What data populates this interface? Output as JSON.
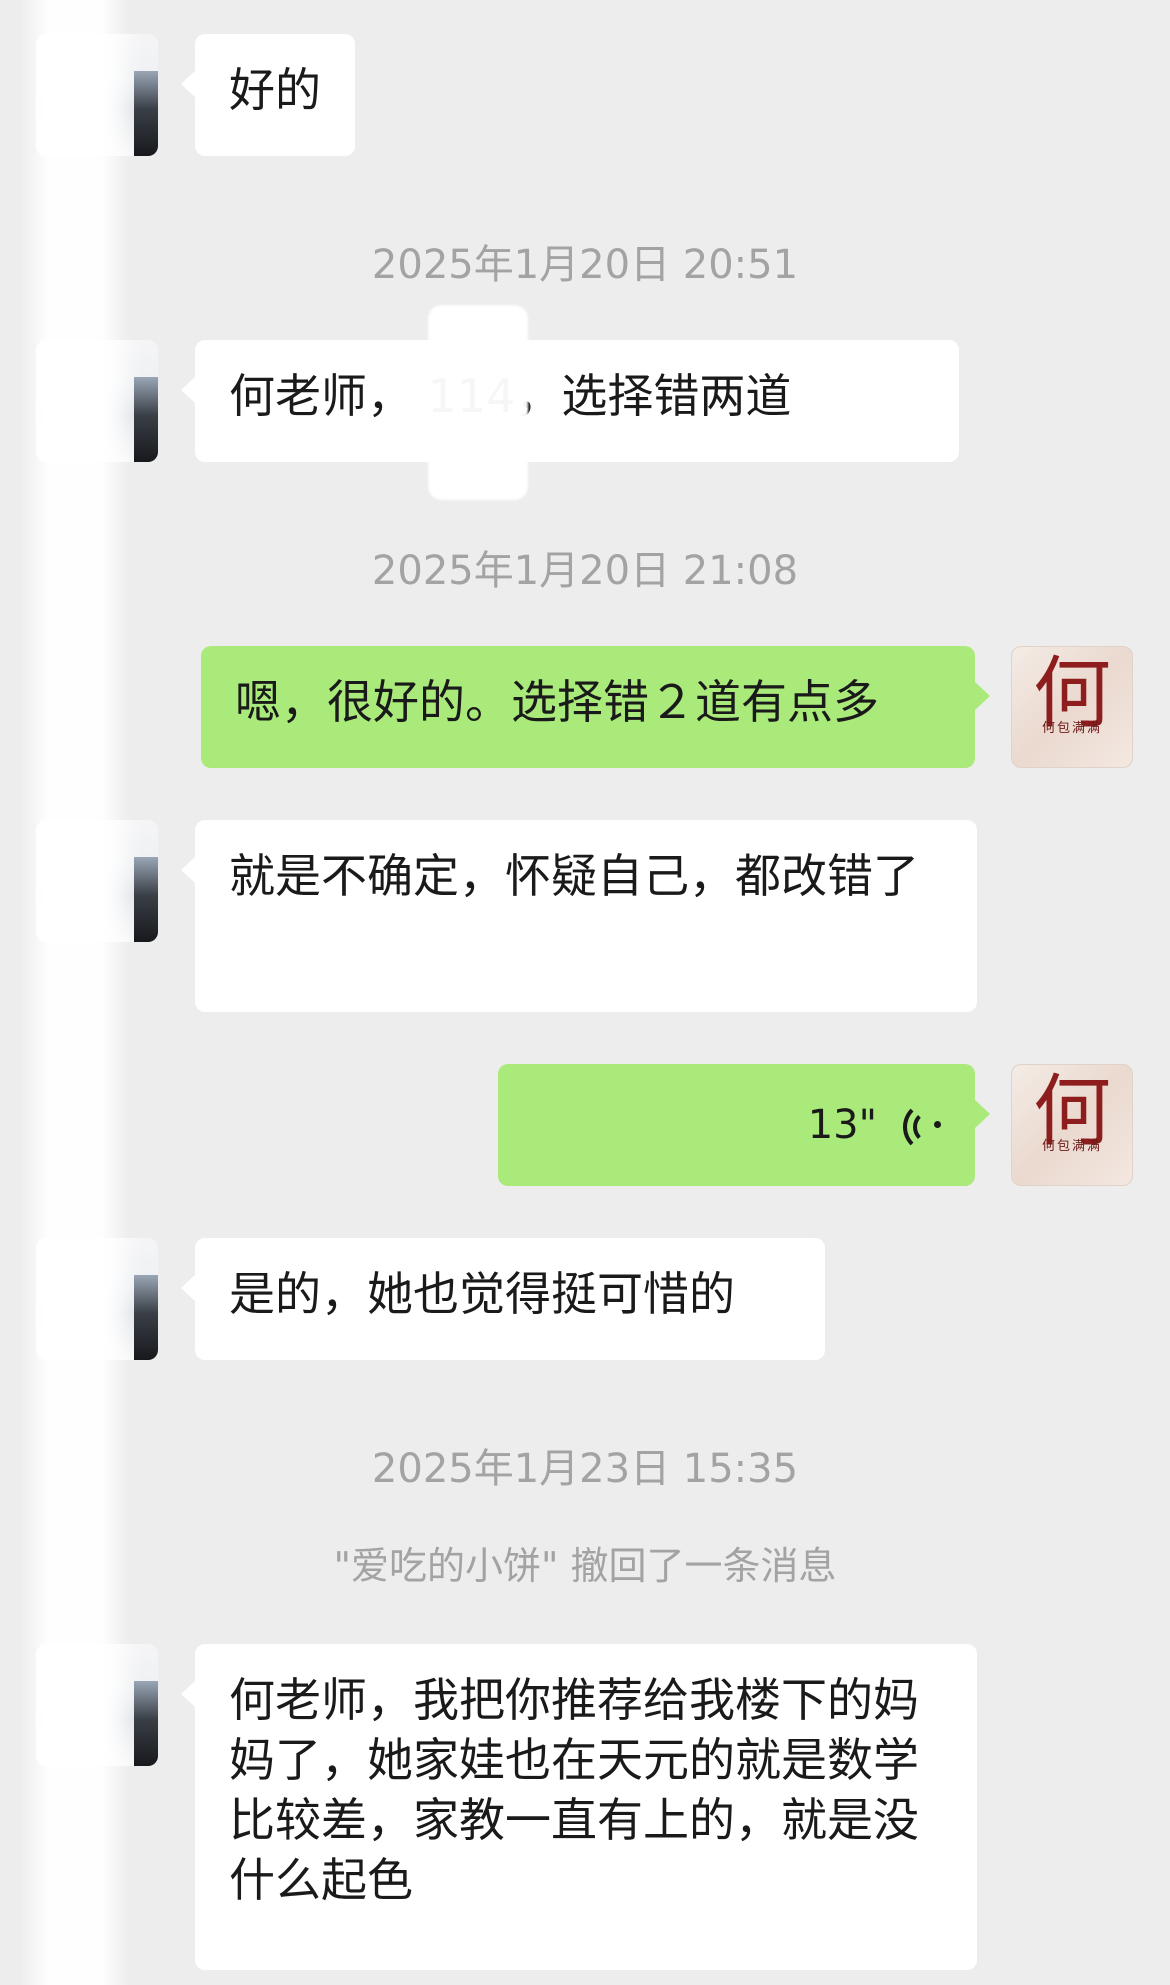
{
  "messages": [
    {
      "side": "incoming",
      "text": "好的"
    },
    {
      "side": "incoming",
      "text": "何老师， 114，选择错两道"
    },
    {
      "side": "outgoing",
      "text": "嗯，很好的。选择错２道有点多"
    },
    {
      "side": "incoming",
      "text": "就是不确定，怀疑自己，都改错了"
    },
    {
      "side": "outgoing",
      "type": "voice",
      "duration": "13\""
    },
    {
      "side": "incoming",
      "text": "是的，她也觉得挺可惜的"
    },
    {
      "side": "incoming",
      "text": "何老师，我把你推荐给我楼下的妈妈了，她家娃也在天元的就是数学比较差，家教一直有上的，就是没什么起色"
    }
  ],
  "timestamps": [
    "2025年1月20日 20:51",
    "2025年1月20日 21:08",
    "2025年1月23日 15:35"
  ],
  "system_message": "\"爱吃的小饼\" 撤回了一条消息",
  "self_avatar": {
    "char": "何",
    "sub": "何包满满"
  },
  "colors": {
    "background": "#ededed",
    "incoming_bubble": "#ffffff",
    "outgoing_bubble": "#a9ea7a",
    "timestamp_text": "#a3a3a3"
  },
  "icons": {
    "voice": "voice-wave-icon"
  }
}
